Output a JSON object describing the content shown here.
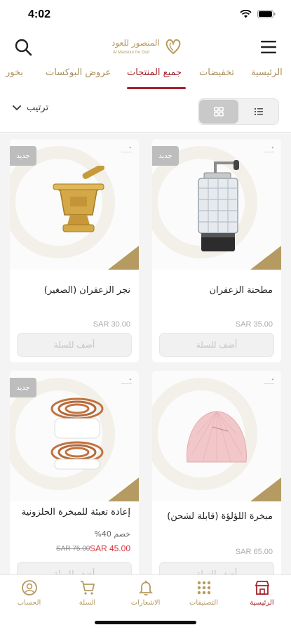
{
  "status_bar": {
    "time": "4:02"
  },
  "header": {
    "logo_ar": "المنصور للعود",
    "logo_en": "Al Mansour for Oud"
  },
  "tabs": [
    {
      "label": "الرئيسية"
    },
    {
      "label": "تخفيضات"
    },
    {
      "label": "جميع المنتجات"
    },
    {
      "label": "عروض البوكسات"
    },
    {
      "label": "بخور"
    }
  ],
  "toolbar": {
    "sort_label": "ترتيب"
  },
  "products": [
    {
      "badge": "جديد",
      "name": "مطحنة الزعفران",
      "price": "SAR 35.00",
      "add_label": "أضف للسلة"
    },
    {
      "badge": "جديد",
      "name": "نجر الزعفران (الصغير)",
      "price": "SAR 30.00",
      "add_label": "أضف للسلة"
    },
    {
      "badge": "",
      "name": "مبخرة اللؤلؤة (قابلة لشحن)",
      "price": "SAR 65.00",
      "add_label": "أضف للسلة"
    },
    {
      "badge": "جديد",
      "name": "إعادة تعبئة للمبخرة الحلزونية",
      "discount": "خصم 40%",
      "price": "SAR 45.00",
      "old_price": "SAR 75.00",
      "add_label": "أضف للسلة"
    }
  ],
  "bottom_nav": [
    {
      "label": "الرئيسية"
    },
    {
      "label": "التصنيفات"
    },
    {
      "label": "الاشعارات"
    },
    {
      "label": "السلة"
    },
    {
      "label": "الحساب"
    }
  ],
  "colors": {
    "accent": "#a3212a",
    "gold": "#b59a62",
    "sale": "#d3343d"
  }
}
